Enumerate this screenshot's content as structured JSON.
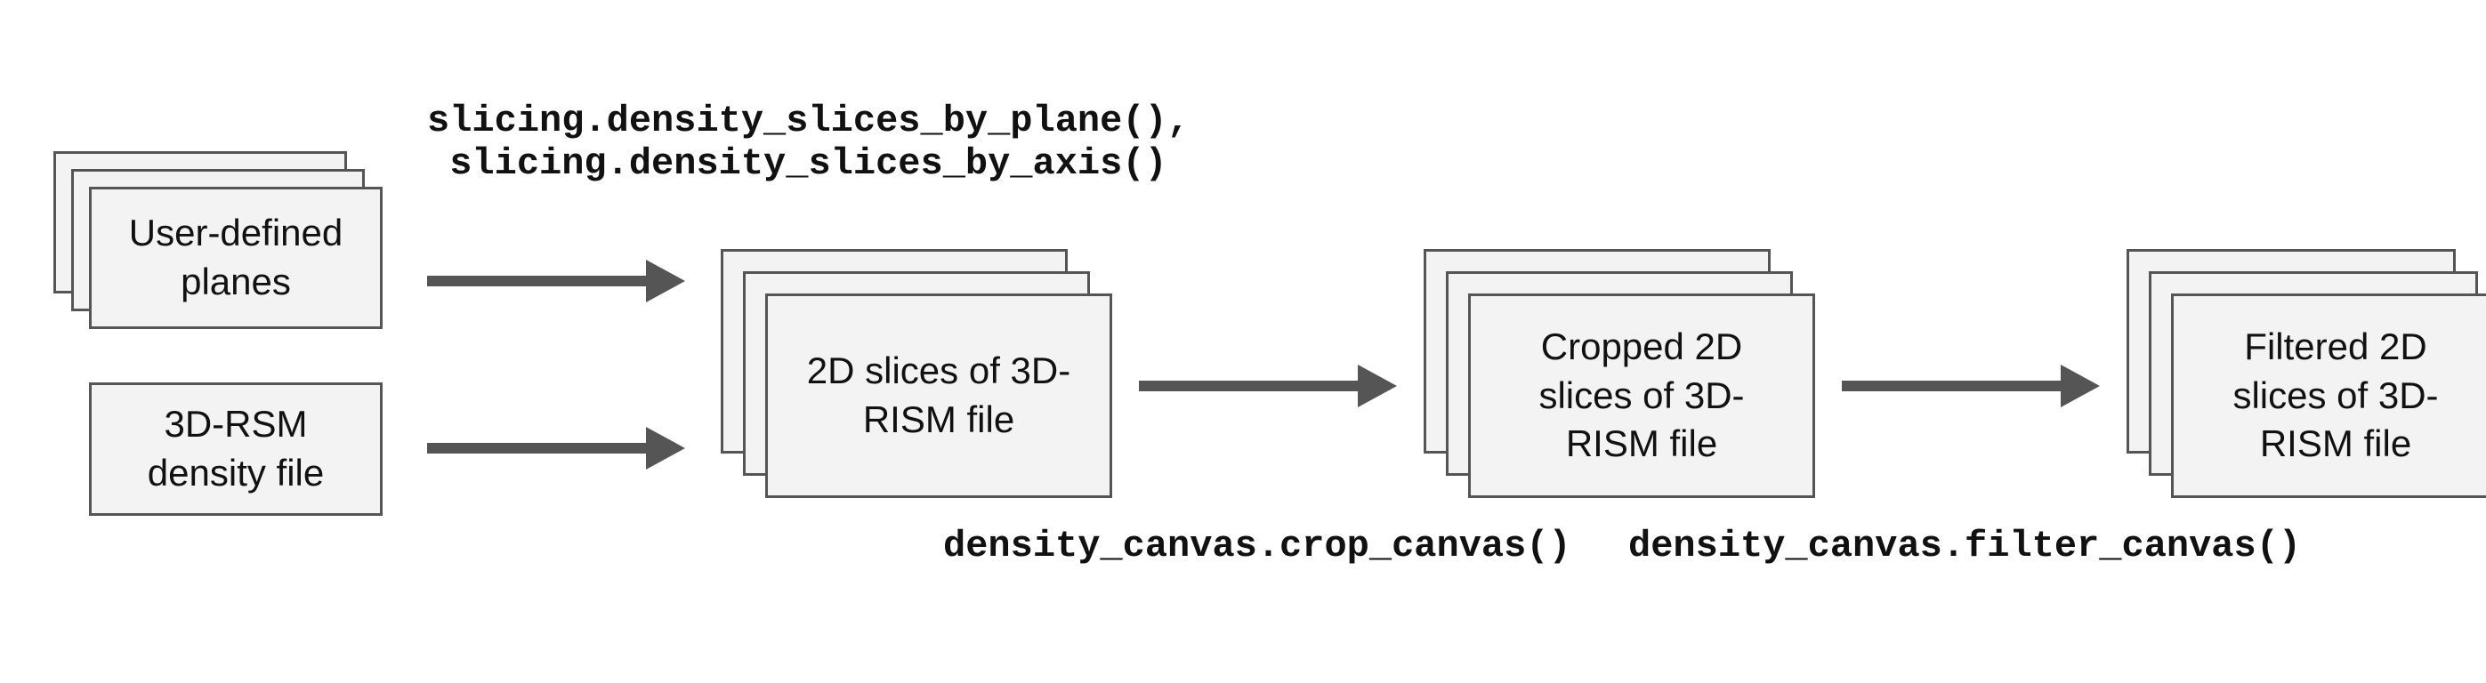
{
  "inputs": {
    "planes_box": "User-defined\nplanes",
    "density_box": "3D-RSM\ndensity file"
  },
  "slicing_fns": "slicing.density_slices_by_plane(),\n slicing.density_slices_by_axis()",
  "slices_box": "2D slices of\n3D-RISM file",
  "crop_fn": "density_canvas.crop_canvas()",
  "cropped_box": "Cropped 2D\nslices of\n3D-RISM file",
  "filter_fn": "density_canvas.filter_canvas()",
  "filtered_box": "Filtered 2D\nslices of\n3D-RISM file"
}
